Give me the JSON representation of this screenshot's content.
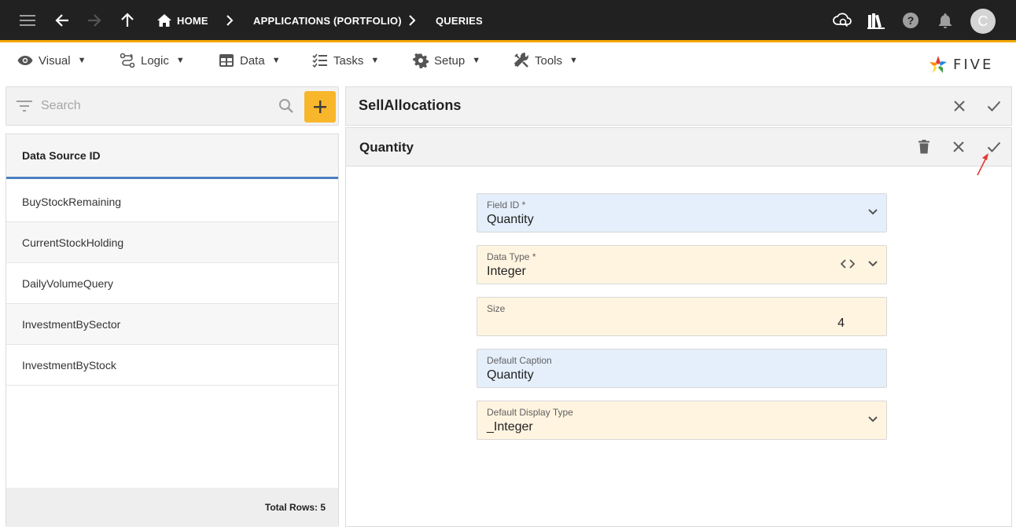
{
  "topbar": {
    "breadcrumbs": [
      "HOME",
      "APPLICATIONS (PORTFOLIO)",
      "QUERIES"
    ],
    "avatar_letter": "C"
  },
  "menu": {
    "items": [
      {
        "label": "Visual",
        "icon": "eye-icon"
      },
      {
        "label": "Logic",
        "icon": "logic-icon"
      },
      {
        "label": "Data",
        "icon": "table-icon"
      },
      {
        "label": "Tasks",
        "icon": "tasks-icon"
      },
      {
        "label": "Setup",
        "icon": "gear-icon"
      },
      {
        "label": "Tools",
        "icon": "tools-icon"
      }
    ],
    "caret": "▼"
  },
  "logo": {
    "text": "FIVE"
  },
  "search": {
    "placeholder": "Search"
  },
  "list": {
    "header": "Data Source ID",
    "rows": [
      "BuyStockRemaining",
      "CurrentStockHolding",
      "DailyVolumeQuery",
      "InvestmentBySector",
      "InvestmentByStock"
    ],
    "footer": "Total Rows: 5"
  },
  "record": {
    "title": "SellAllocations"
  },
  "detail": {
    "title": "Quantity",
    "fields": [
      {
        "label": "Field ID *",
        "value": "Quantity"
      },
      {
        "label": "Data Type *",
        "value": "Integer"
      },
      {
        "label": "Size",
        "value": "4"
      },
      {
        "label": "Default Caption",
        "value": "Quantity"
      },
      {
        "label": "Default Display Type",
        "value": "_Integer"
      }
    ]
  },
  "colors": {
    "topbar": "#212121",
    "accent": "#f5a800",
    "add_button": "#f8b62a",
    "list_header_underline": "#4a7fc1",
    "field_blue": "#e4effb",
    "field_amber": "#fff4e0"
  }
}
